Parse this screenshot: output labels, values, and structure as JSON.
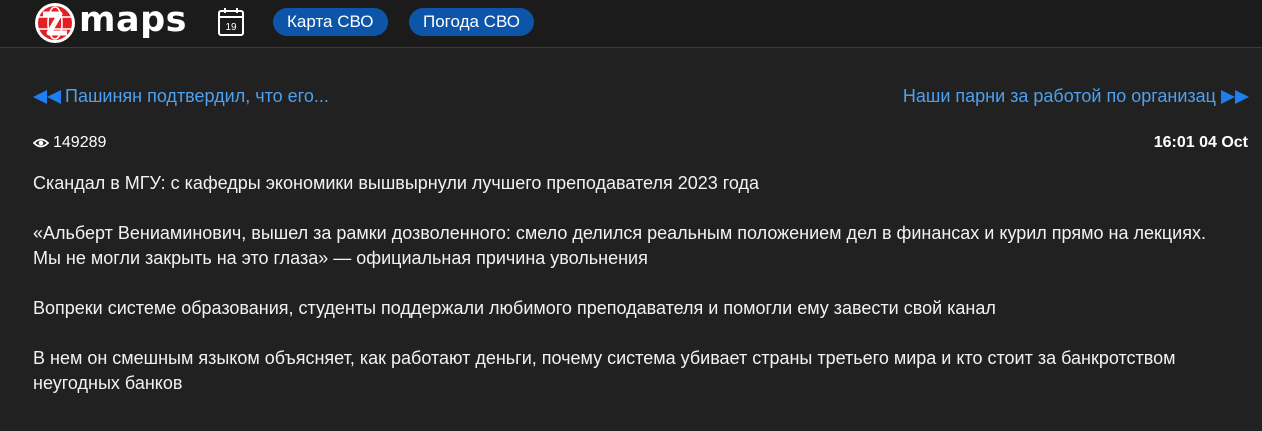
{
  "header": {
    "logo_text": "maps",
    "calendar_day": "19",
    "pills": [
      "Карта СВО",
      "Погода СВО"
    ]
  },
  "nav": {
    "prev_label": "Пашинян подтвердил, что его...",
    "next_label": "Наши парни за работой по организац"
  },
  "meta": {
    "views": "149289",
    "timestamp": "16:01 04 Oct"
  },
  "post": {
    "paragraphs": [
      "Скандал в МГУ: с кафедры экономики вышвырнули лучшего преподавателя 2023 года",
      "«Альберт Вениаминович, вышел за рамки дозволенного: смело делился реальным положением дел в финансах и курил прямо на лекциях. Мы не могли закрыть на это глаза» — официальная причина увольнения",
      "Вопреки системе образования, студенты поддержали любимого преподавателя и помогли ему завести свой канал",
      "В нем он смешным языком объясняет, как работают деньги, почему система убивает страны третьего мира и кто стоит за банкротством неугодных банков"
    ]
  },
  "colors": {
    "background": "#212121",
    "header": "#1b1b1b",
    "pill": "#0d55a8",
    "link": "#4ea0f0",
    "logo_red": "#e31e24"
  }
}
